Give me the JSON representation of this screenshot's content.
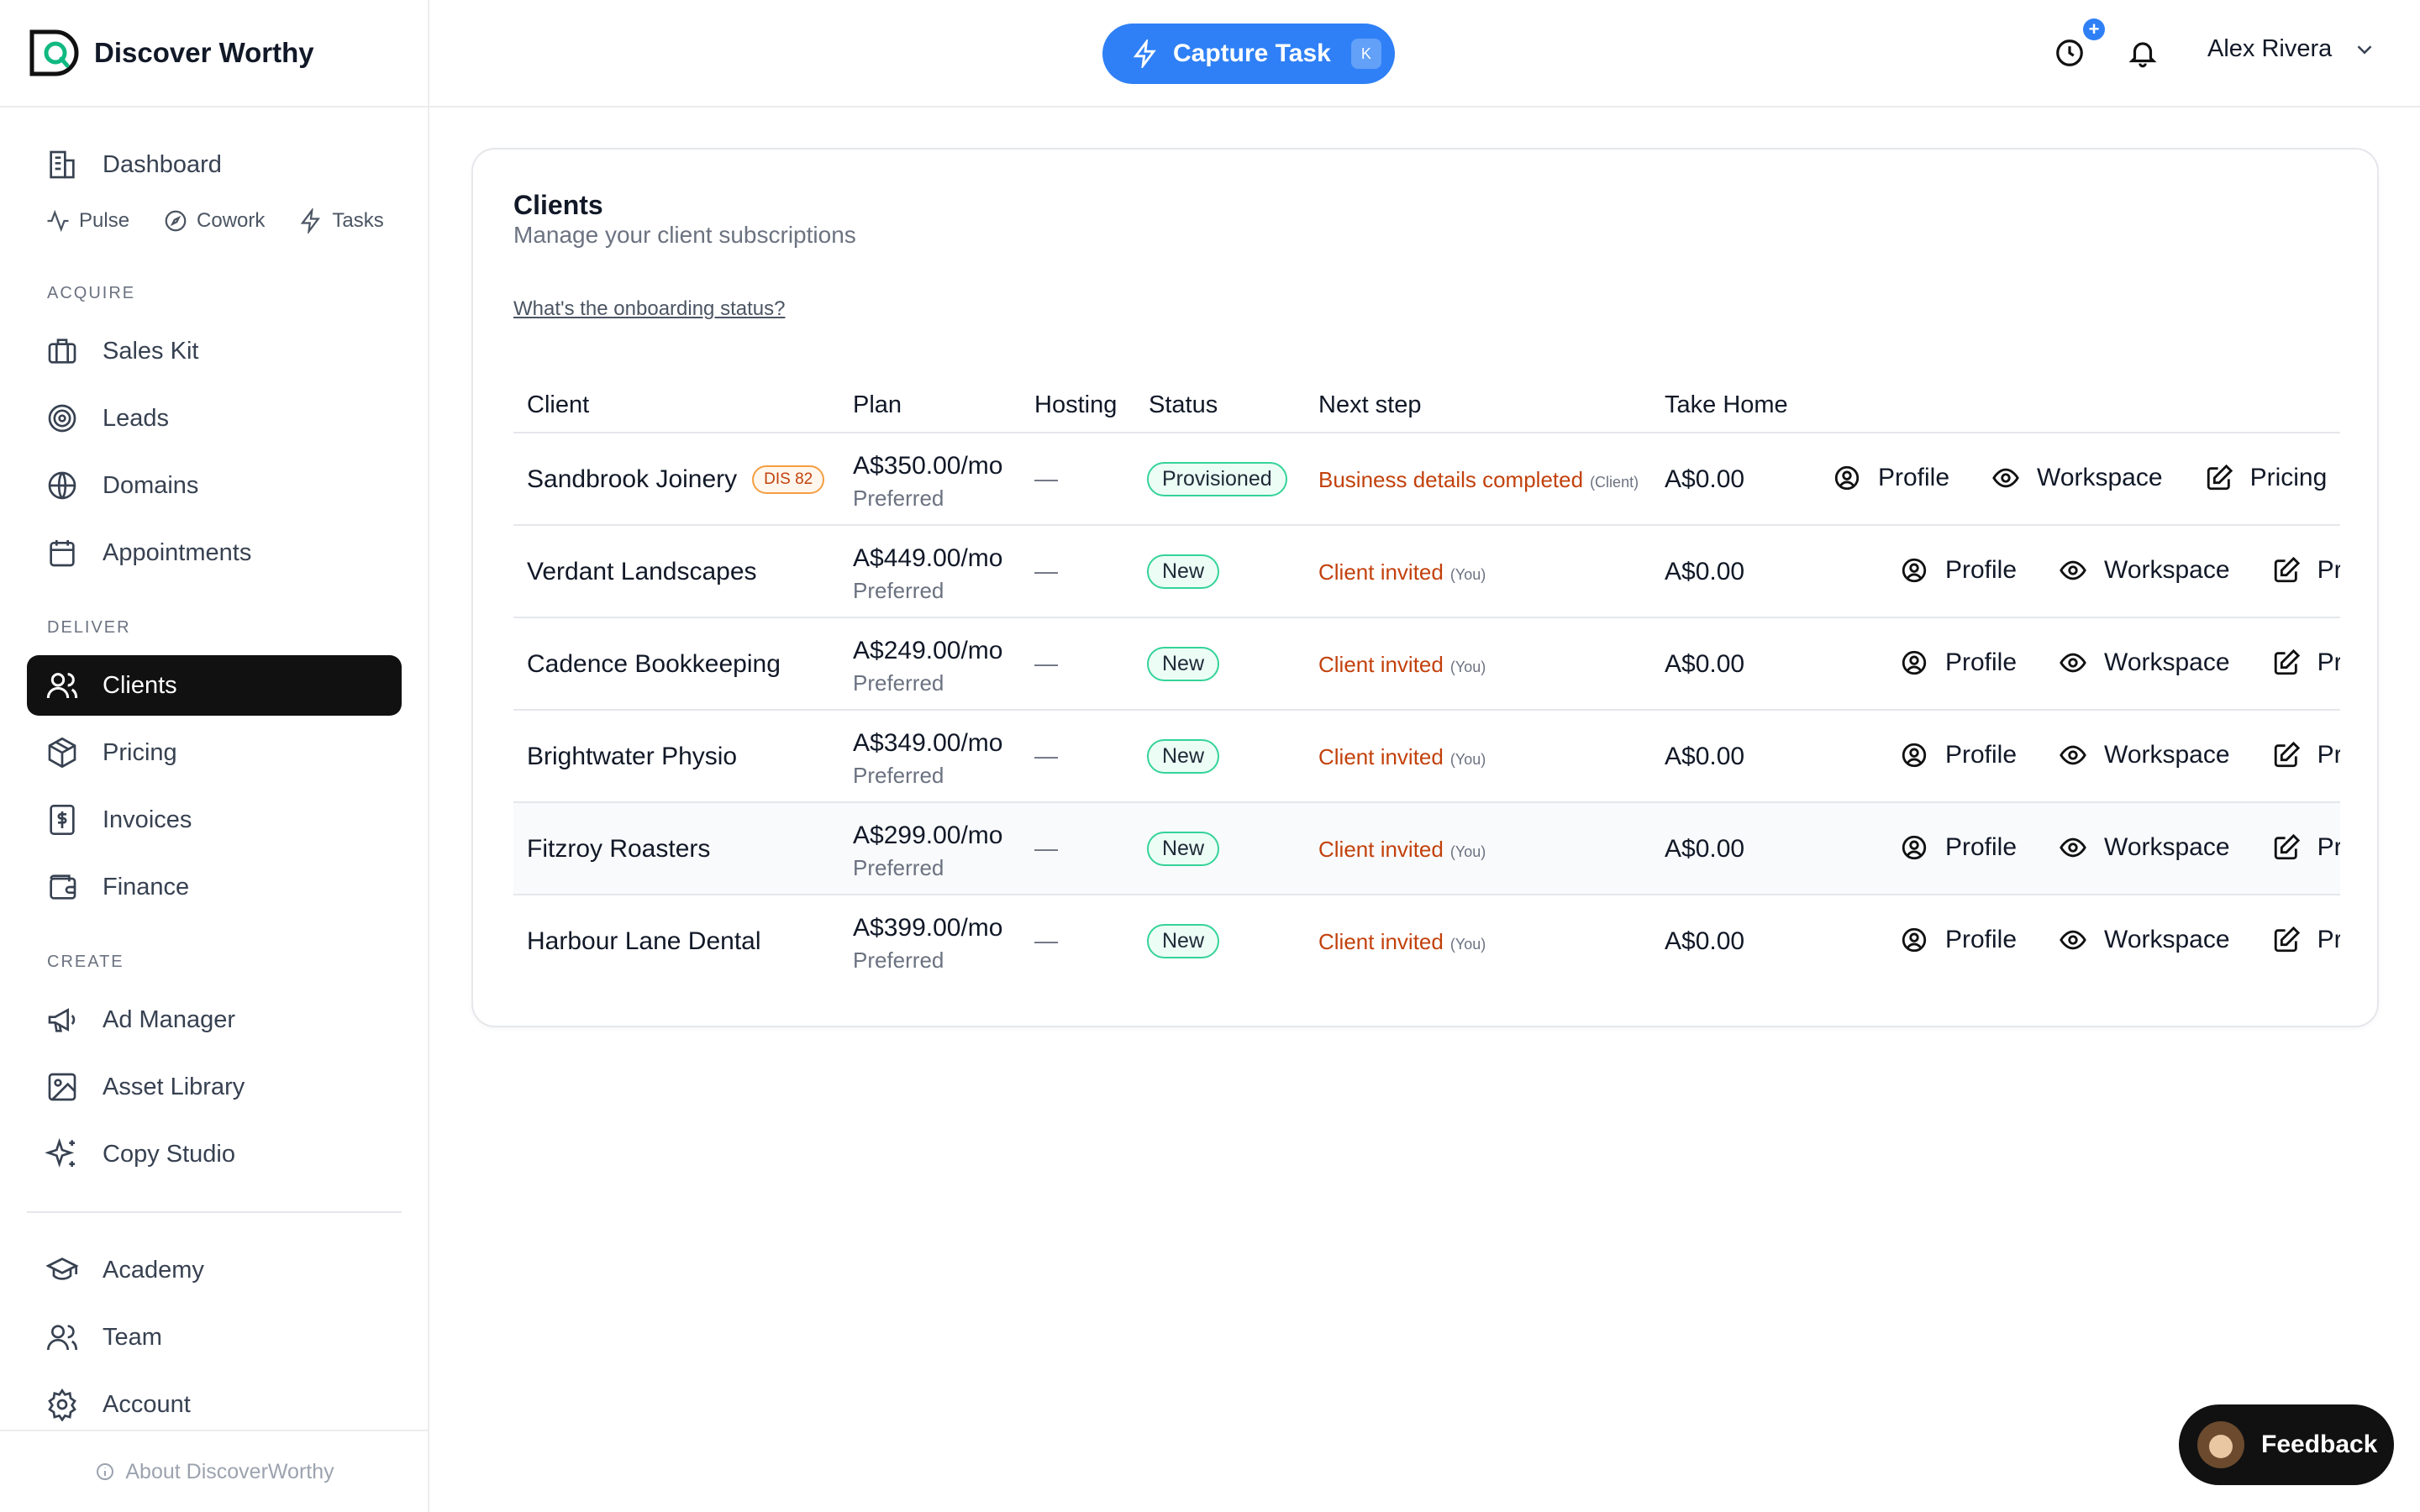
{
  "brand": {
    "name": "Discover Worthy"
  },
  "sidebar": {
    "dashboard": "Dashboard",
    "quick": [
      "Pulse",
      "Cowork",
      "Tasks"
    ],
    "sections": {
      "acquire": "ACQUIRE",
      "deliver": "DELIVER",
      "create": "CREATE"
    },
    "acquire_items": [
      "Sales Kit",
      "Leads",
      "Domains",
      "Appointments"
    ],
    "deliver_items": [
      "Clients",
      "Pricing",
      "Invoices",
      "Finance"
    ],
    "create_items": [
      "Ad Manager",
      "Asset Library",
      "Copy Studio"
    ],
    "bottom_items": [
      "Academy",
      "Team",
      "Account"
    ],
    "about": "About DiscoverWorthy",
    "active": "Clients"
  },
  "topbar": {
    "capture_label": "Capture Task",
    "capture_shortcut": "K",
    "notification_badge": "+",
    "user_name": "Alex Rivera"
  },
  "clients_page": {
    "title": "Clients",
    "subtitle": "Manage your client subscriptions",
    "onboarding_link": "What's the onboarding status?",
    "columns": [
      "Client",
      "Plan",
      "Hosting",
      "Status",
      "Next step",
      "Take Home"
    ],
    "rows": [
      {
        "client": "Sandbrook Joinery",
        "badge": "DIS 82",
        "plan": "A$350.00/mo",
        "plan_tier": "Preferred",
        "hosting": "—",
        "status": "Provisioned",
        "next_step": "Business details completed",
        "next_by": "(Client)",
        "take_home": "A$0.00",
        "actions": [
          "Profile",
          "Workspace",
          "Pricing"
        ]
      },
      {
        "client": "Verdant Landscapes",
        "badge": "",
        "plan": "A$449.00/mo",
        "plan_tier": "Preferred",
        "hosting": "—",
        "status": "New",
        "next_step": "Client invited",
        "next_by": "(You)",
        "take_home": "A$0.00",
        "actions": [
          "Profile",
          "Workspace",
          "Pr"
        ]
      },
      {
        "client": "Cadence Bookkeeping",
        "badge": "",
        "plan": "A$249.00/mo",
        "plan_tier": "Preferred",
        "hosting": "—",
        "status": "New",
        "next_step": "Client invited",
        "next_by": "(You)",
        "take_home": "A$0.00",
        "actions": [
          "Profile",
          "Workspace",
          "Pr"
        ]
      },
      {
        "client": "Brightwater Physio",
        "badge": "",
        "plan": "A$349.00/mo",
        "plan_tier": "Preferred",
        "hosting": "—",
        "status": "New",
        "next_step": "Client invited",
        "next_by": "(You)",
        "take_home": "A$0.00",
        "actions": [
          "Profile",
          "Workspace",
          "Pr"
        ]
      },
      {
        "client": "Fitzroy Roasters",
        "badge": "",
        "plan": "A$299.00/mo",
        "plan_tier": "Preferred",
        "hosting": "—",
        "status": "New",
        "next_step": "Client invited",
        "next_by": "(You)",
        "take_home": "A$0.00",
        "actions": [
          "Profile",
          "Workspace",
          "Pr"
        ]
      },
      {
        "client": "Harbour Lane Dental",
        "badge": "",
        "plan": "A$399.00/mo",
        "plan_tier": "Preferred",
        "hosting": "—",
        "status": "New",
        "next_step": "Client invited",
        "next_by": "(You)",
        "take_home": "A$0.00",
        "actions": [
          "Profile",
          "Workspace",
          "Pr"
        ]
      }
    ]
  },
  "feedback": {
    "label": "Feedback"
  },
  "colors": {
    "accent": "#2f80f6",
    "active_nav": "#111111",
    "next_step": "#c2410c",
    "status_border": "#34d399"
  }
}
